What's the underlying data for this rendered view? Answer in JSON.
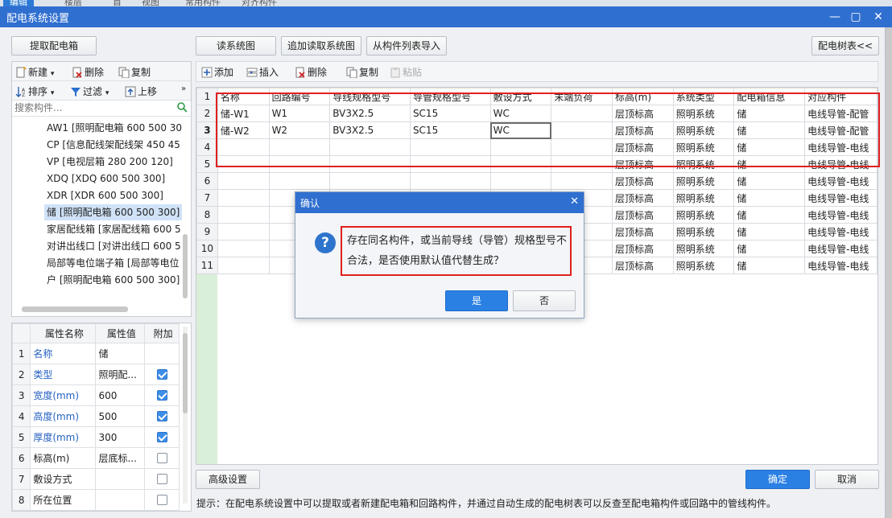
{
  "top_tabs": [
    "编辑",
    "楼层",
    "首",
    "视图",
    "常用构件",
    "对齐构件"
  ],
  "window": {
    "title": "配电系统设置"
  },
  "left": {
    "extract_button": "提取配电箱",
    "toolbar1": {
      "new": "新建",
      "delete": "删除",
      "copy": "复制"
    },
    "toolbar2": {
      "sort": "排序",
      "filter": "过滤",
      "move_up": "上移"
    },
    "search_placeholder": "搜索构件...",
    "tree_items": [
      "AW1 [照明配电箱 600 500 30",
      "CP [信息配线架配线架 450 45",
      "VP [电视层箱 280 200 120]",
      "XDQ [XDQ 600 500 300]",
      "XDR [XDR 600 500 300]",
      "储 [照明配电箱 600 500 300]",
      "家居配线箱 [家居配线箱 600 5",
      "对讲出线口 [对讲出线口 600 5",
      "局部等电位端子箱 [局部等电位",
      "户 [照明配电箱 600 500 300]"
    ],
    "selected_index": 5,
    "props": {
      "headers": [
        "属性名称",
        "属性值",
        "附加"
      ],
      "rows": [
        {
          "n": "1",
          "name": "名称",
          "value": "储",
          "blue": true,
          "check": null
        },
        {
          "n": "2",
          "name": "类型",
          "value": "照明配...",
          "blue": true,
          "check": true
        },
        {
          "n": "3",
          "name": "宽度(mm)",
          "value": "600",
          "blue": true,
          "check": true
        },
        {
          "n": "4",
          "name": "高度(mm)",
          "value": "500",
          "blue": true,
          "check": true
        },
        {
          "n": "5",
          "name": "厚度(mm)",
          "value": "300",
          "blue": true,
          "check": true
        },
        {
          "n": "6",
          "name": "标高(m)",
          "value": "层底标...",
          "blue": false,
          "check": false
        },
        {
          "n": "7",
          "name": "敷设方式",
          "value": "",
          "blue": false,
          "check": false
        },
        {
          "n": "8",
          "name": "所在位置",
          "value": "",
          "blue": false,
          "check": false
        }
      ]
    }
  },
  "right": {
    "buttons": {
      "read": "读系统图",
      "append": "追加读取系统图",
      "import": "从构件列表导入",
      "tree": "配电树表<<"
    },
    "toolbar": {
      "add": "添加",
      "insert": "插入",
      "delete": "删除",
      "copy": "复制",
      "paste": "粘贴"
    },
    "grid": {
      "headers": [
        "名称",
        "回路编号",
        "导线规格型号",
        "导管规格型号",
        "敷设方式",
        "末端负荷",
        "标高(m)",
        "系统类型",
        "配电箱信息",
        "对应构件"
      ],
      "rows": [
        [
          "储-W1",
          "W1",
          "BV3X2.5",
          "SC15",
          "WC",
          "",
          "层顶标高",
          "照明系统",
          "储",
          "电线导管-配管"
        ],
        [
          "储-W2",
          "W2",
          "BV3X2.5",
          "SC15",
          "WC",
          "",
          "层顶标高",
          "照明系统",
          "储",
          "电线导管-配管"
        ],
        [
          "",
          "",
          "",
          "",
          "",
          "",
          "层顶标高",
          "照明系统",
          "储",
          "电线导管-电线"
        ],
        [
          "",
          "",
          "",
          "",
          "",
          "",
          "层顶标高",
          "照明系统",
          "储",
          "电线导管-电线"
        ],
        [
          "",
          "",
          "",
          "",
          "",
          "",
          "层顶标高",
          "照明系统",
          "储",
          "电线导管-电线"
        ],
        [
          "",
          "",
          "",
          "",
          "",
          "",
          "层顶标高",
          "照明系统",
          "储",
          "电线导管-电线"
        ],
        [
          "",
          "",
          "",
          "",
          "",
          "",
          "层顶标高",
          "照明系统",
          "储",
          "电线导管-电线"
        ],
        [
          "",
          "",
          "",
          "",
          "",
          "",
          "层顶标高",
          "照明系统",
          "储",
          "电线导管-电线"
        ],
        [
          "",
          "",
          "",
          "",
          "",
          "",
          "层顶标高",
          "照明系统",
          "储",
          "电线导管-电线"
        ],
        [
          "",
          "",
          "",
          "",
          "",
          "",
          "层顶标高",
          "照明系统",
          "储",
          "电线导管-电线"
        ]
      ]
    },
    "advanced": "高级设置",
    "ok": "确定",
    "cancel": "取消"
  },
  "dialog": {
    "title": "确认",
    "message": "存在同名构件，或当前导线（导管）规格型号不合法，是否使用默认值代替生成？",
    "yes": "是",
    "no": "否"
  },
  "hint": "提示：在配电系统设置中可以提取或者新建配电箱和回路构件，并通过自动生成的配电树表可以反查至配电箱构件或回路中的管线构件。",
  "colors": {
    "titlebar": "#2f6fd0",
    "primary_button": "#2b80e4",
    "highlight_box": "#e02020"
  }
}
